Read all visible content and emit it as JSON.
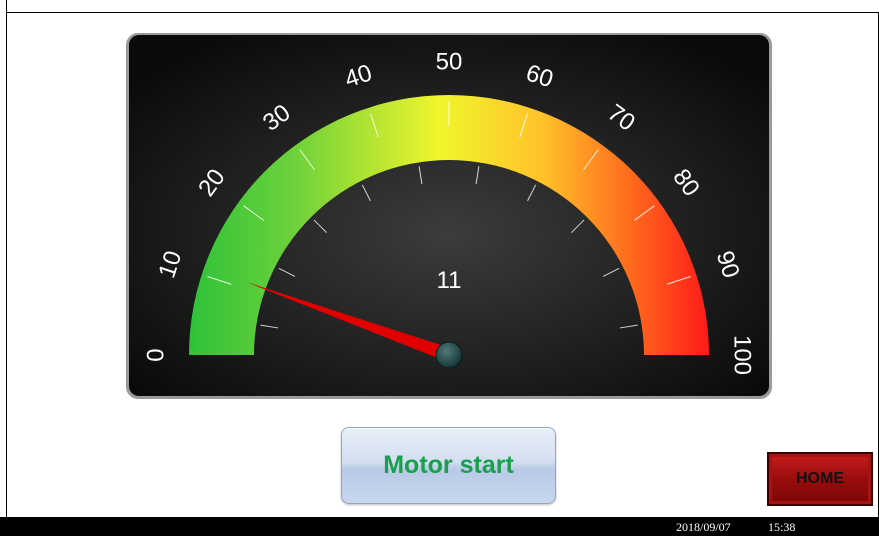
{
  "gauge": {
    "value": 11,
    "min": 0,
    "max": 100,
    "scale_labels": [
      "0",
      "10",
      "20",
      "30",
      "40",
      "50",
      "60",
      "70",
      "80",
      "90",
      "100"
    ],
    "colors": {
      "low": "#2fc23a",
      "mid": "#f4f42a",
      "high": "#ff1a1a",
      "needle": "#e00000",
      "panel": "#2a2a2a"
    }
  },
  "buttons": {
    "motor_label": "Motor start",
    "home_label": "HOME"
  },
  "status_bar": {
    "date": "2018/09/07",
    "time": "15:38"
  }
}
